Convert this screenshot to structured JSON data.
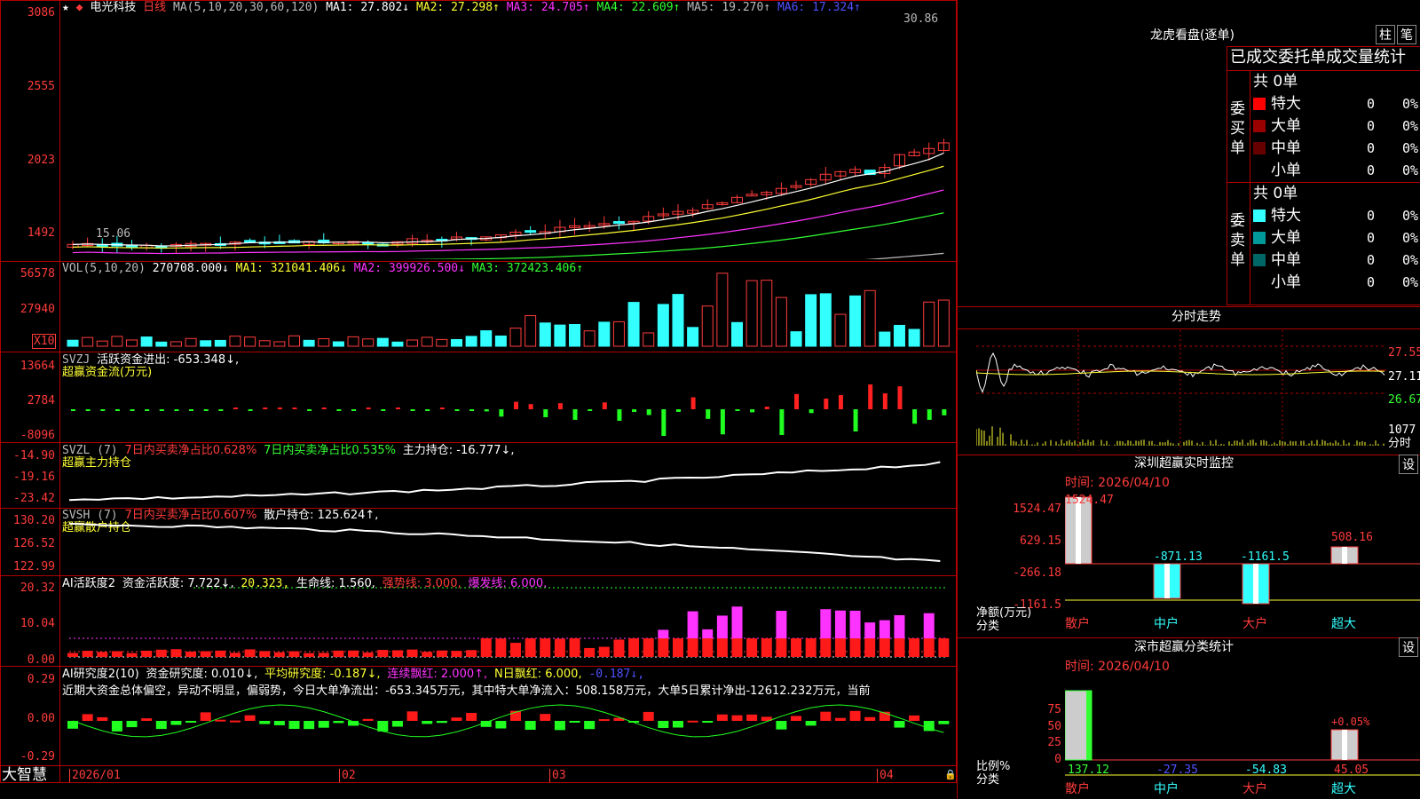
{
  "stock": {
    "name": "电光科技",
    "period": "日线",
    "star": "★"
  },
  "main_chart": {
    "ma_label": "MA(5,10,20,30,60,120)",
    "ma1": "MA1: 27.802↓",
    "ma2": "MA2: 27.298↑",
    "ma3": "MA3: 24.705↑",
    "ma4": "MA4: 22.609↑",
    "ma5": "MA5: 19.270↑",
    "ma6": "MA6: 17.324↑",
    "y_ticks": [
      "3086",
      "2555",
      "2023",
      "1492"
    ],
    "high_label": "30.86",
    "low_label": "15.06"
  },
  "vol_panel": {
    "title": "VOL(5,10,20)",
    "value": "270708.000↓",
    "ma1": "MA1: 321041.406↓",
    "ma2": "MA2: 399926.500↓",
    "ma3": "MA3: 372423.406↑",
    "y_ticks": [
      "56578",
      "27940"
    ],
    "unit": "X10"
  },
  "svzj_panel": {
    "title": "SVZJ",
    "label": "活跃资金进出: -653.348↓,",
    "subtitle": "超赢资金流(万元)",
    "y_ticks": [
      "13664",
      "2784",
      "-8096"
    ]
  },
  "svzl_panel": {
    "title": "SVZL (7)",
    "a": "7日内买卖净占比0.628%",
    "b": "7日内买卖净占比0.535%",
    "c": "主力持仓: -16.777↓,",
    "subtitle": "超赢主力持仓",
    "y_ticks": [
      "-14.90",
      "-19.16",
      "-23.42"
    ]
  },
  "svsh_panel": {
    "title": "SVSH (7)",
    "a": "7日内买卖净占比0.607%",
    "c": "散户持仓: 125.624↑,",
    "subtitle": "超赢散户持仓",
    "y_ticks": [
      "130.20",
      "126.52",
      "122.99"
    ]
  },
  "ai_active": {
    "title": "AI活跃度2",
    "a": "资金活跃度: 7.722↓,",
    "b": "20.323,",
    "c": "生命线: 1.560,",
    "d": "强势线: 3.000,",
    "e": "爆发线: 6.000,",
    "y_ticks": [
      "20.32",
      "10.04",
      "0.00"
    ]
  },
  "ai_research": {
    "title": "AI研究度2(10)",
    "a": "资金研究度: 0.010↓,",
    "b": "平均研究度: -0.187↓,",
    "c": "连续飘红: 2.000↑,",
    "d": "N日飘红: 6.000,",
    "e": "-0.187↓,",
    "summary": "近期大资金总体偏空，异动不明显，偏弱势，今日大单净流出：-653.345万元，其中特大单净流入：508.158万元，大单5日累计净出-12612.232万元，当前",
    "y_ticks": [
      "0.29",
      "0.00",
      "-0.29"
    ]
  },
  "x_axis": {
    "labels": [
      "2026/01",
      "02",
      "03",
      "04"
    ],
    "brand": "大智慧"
  },
  "right": {
    "lhb_title": "龙虎看盘(逐单)",
    "btn_zhu": "柱",
    "btn_bi": "笔",
    "tabs": "已成交委托单成交量统计",
    "buy": {
      "side": "委买单",
      "total": "共 0单",
      "rows": [
        {
          "label": "特大",
          "count": "0",
          "pct": "0%",
          "color": "#ff0000"
        },
        {
          "label": "大单",
          "count": "0",
          "pct": "0%",
          "color": "#990000"
        },
        {
          "label": "中单",
          "count": "0",
          "pct": "0%",
          "color": "#660000"
        },
        {
          "label": "小单",
          "count": "0",
          "pct": "0%",
          "color": "#000000"
        }
      ]
    },
    "sell": {
      "side": "委卖单",
      "total": "共 0单",
      "rows": [
        {
          "label": "特大",
          "count": "0",
          "pct": "0%",
          "color": "#33ffff"
        },
        {
          "label": "大单",
          "count": "0",
          "pct": "0%",
          "color": "#009999"
        },
        {
          "label": "中单",
          "count": "0",
          "pct": "0%",
          "color": "#006666"
        },
        {
          "label": "小单",
          "count": "0",
          "pct": "0%",
          "color": "#000000"
        }
      ]
    },
    "intraday": {
      "title": "分时走势",
      "prices": [
        "27.55",
        "27.11",
        "26.67"
      ],
      "vol": "1077",
      "vol_unit": "分时"
    },
    "sz_monitor": {
      "title": "深圳超赢实时监控",
      "btn": "设",
      "time": "时间: 2026/04/10",
      "y_ticks": [
        "1524.47",
        "629.15",
        "-266.18",
        "-1161.5"
      ],
      "bars": [
        {
          "label": "散户",
          "value": "1524.47"
        },
        {
          "label": "中户",
          "value": "-871.13"
        },
        {
          "label": "大户",
          "value": "-1161.5"
        },
        {
          "label": "超大",
          "value": "508.16"
        }
      ],
      "axis_label1": "净额(万元)",
      "axis_label2": "分类"
    },
    "sz_classify": {
      "title": "深市超赢分类统计",
      "btn": "设",
      "time": "时间: 2026/04/10",
      "y_ticks": [
        "75",
        "50",
        "25",
        "0"
      ],
      "bars": [
        {
          "label": "散户",
          "value": "137.12"
        },
        {
          "label": "中户",
          "value": "-27.35"
        },
        {
          "label": "大户",
          "value": "-54.83"
        },
        {
          "label": "超大",
          "value": "45.05"
        }
      ],
      "pct_label": "+0.05%",
      "axis_label1": "比例%",
      "axis_label2": "分类"
    }
  }
}
